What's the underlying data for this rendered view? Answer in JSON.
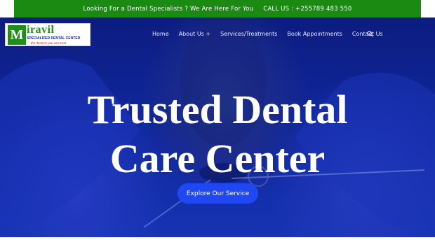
{
  "topbar": {
    "message": "Looking For a Dental Specialists ? We Are Here For You",
    "call": "CALL US : +255789 483 550"
  },
  "logo": {
    "letter": "M",
    "name": "iravil",
    "subtitle": "SPECIALIZED DENTAL CENTER",
    "tagline": "the dentists you can trust"
  },
  "nav": {
    "items": [
      "Home",
      "About Us +",
      "Services/Treatments",
      "Book Appointments",
      "Contact Us"
    ]
  },
  "hero": {
    "headline_line1": "Trusted Dental",
    "headline_line2": "Care Center",
    "cta_label": "Explore Our Service"
  },
  "icons": {
    "search": "search-icon"
  },
  "colors": {
    "topbar": "#1a8a12",
    "hero": "#1430b8",
    "cta": "#1f48f2"
  }
}
